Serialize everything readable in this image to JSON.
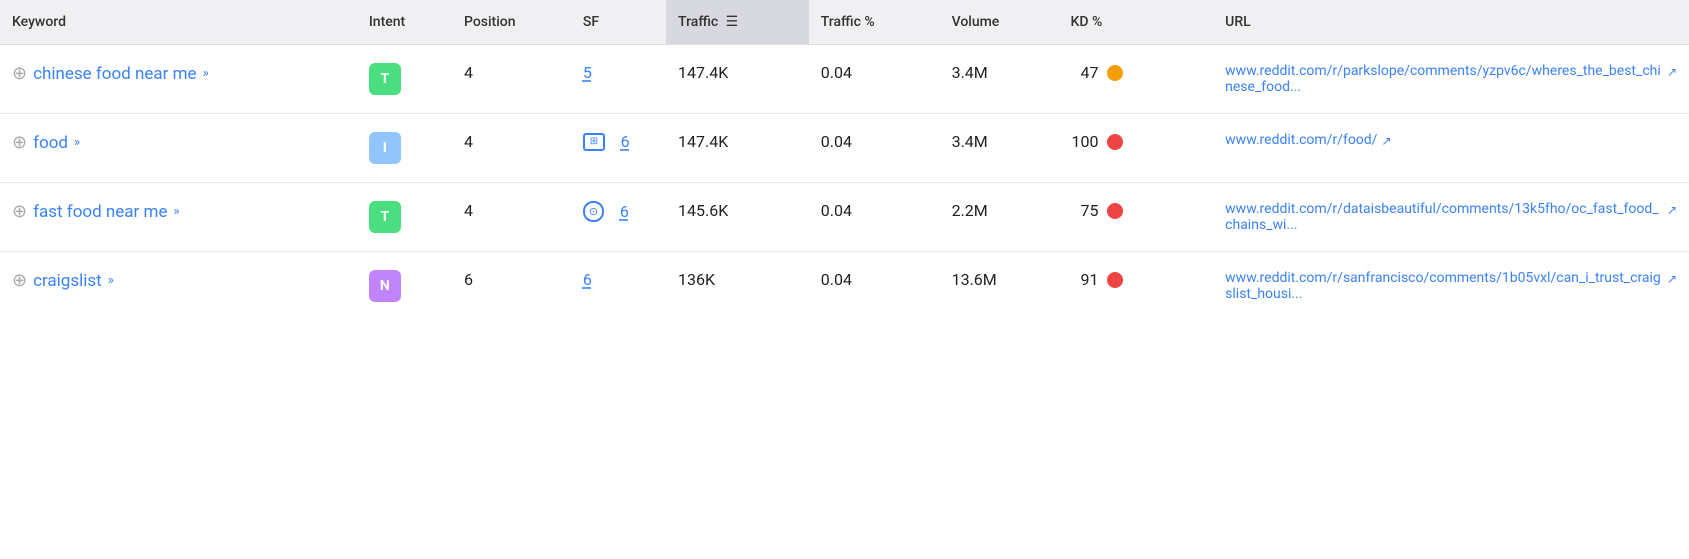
{
  "columns": {
    "keyword": "Keyword",
    "intent": "Intent",
    "position": "Position",
    "sf": "SF",
    "traffic": "Traffic",
    "traffic_pct": "Traffic %",
    "volume": "Volume",
    "kd": "KD %",
    "url": "URL"
  },
  "rows": [
    {
      "keyword": "chinese food near me",
      "intent_label": "T",
      "intent_class": "intent-t",
      "position": "4",
      "sf": "5",
      "sf_icon": "none",
      "traffic": "147.4K",
      "traffic_pct": "0.04",
      "volume": "3.4M",
      "kd": "47",
      "kd_color": "kd-yellow",
      "url_text": "www.reddit.com/r/parkslope/comments/yzpv6c/wheres_the_best_chinese_food...",
      "url_href": "#"
    },
    {
      "keyword": "food",
      "intent_label": "I",
      "intent_class": "intent-i",
      "position": "4",
      "sf": "6",
      "sf_icon": "image",
      "traffic": "147.4K",
      "traffic_pct": "0.04",
      "volume": "3.4M",
      "kd": "100",
      "kd_color": "kd-red",
      "url_text": "www.reddit.com/r/food/",
      "url_href": "#"
    },
    {
      "keyword": "fast food near me",
      "intent_label": "T",
      "intent_class": "intent-t",
      "position": "4",
      "sf": "6",
      "sf_icon": "link",
      "traffic": "145.6K",
      "traffic_pct": "0.04",
      "volume": "2.2M",
      "kd": "75",
      "kd_color": "kd-red",
      "url_text": "www.reddit.com/r/dataisbeautiful/comments/13k5fho/oc_fast_food_chains_wi...",
      "url_href": "#"
    },
    {
      "keyword": "craigslist",
      "intent_label": "N",
      "intent_class": "intent-n",
      "position": "6",
      "sf": "6",
      "sf_icon": "none",
      "traffic": "136K",
      "traffic_pct": "0.04",
      "volume": "13.6M",
      "kd": "91",
      "kd_color": "kd-red",
      "url_text": "www.reddit.com/r/sanfrancisco/comments/1b05vxl/can_i_trust_craigslist_housi...",
      "url_href": "#"
    }
  ],
  "icons": {
    "add": "⊕",
    "chevron": "»",
    "external": "↗",
    "sort": "≡",
    "image_symbol": "⊞",
    "link_symbol": "⊙"
  }
}
